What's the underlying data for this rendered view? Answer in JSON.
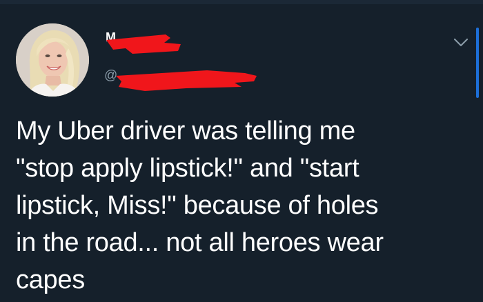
{
  "header": {
    "display_name": "M",
    "handle": "@"
  },
  "tweet": {
    "text": "My Uber driver was telling me\n\"stop apply lipstick!\" and \"start\nlipstick, Miss!\" because of holes\nin the road... not all heroes wear\ncapes"
  },
  "icons": {
    "menu": "chevron-down-icon",
    "avatar": "profile-photo"
  },
  "colors": {
    "background": "#15202b",
    "text": "#ffffff",
    "secondary_text": "#8899a6",
    "redaction": "#f0161b",
    "accent": "#1d6fd8"
  }
}
